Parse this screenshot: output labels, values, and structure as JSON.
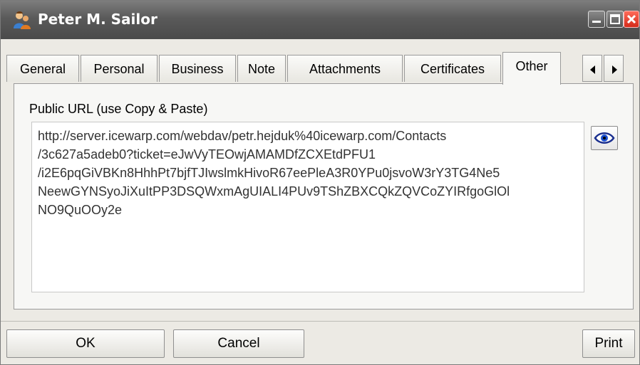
{
  "window": {
    "title": "Peter M. Sailor"
  },
  "tabs": [
    {
      "label": "General"
    },
    {
      "label": "Personal"
    },
    {
      "label": "Business"
    },
    {
      "label": "Note"
    },
    {
      "label": "Attachments"
    },
    {
      "label": "Certificates"
    },
    {
      "label": "Other"
    }
  ],
  "active_tab": "Other",
  "public_url": {
    "label": "Public URL (use Copy & Paste)",
    "lines": [
      "http://server.icewarp.com/webdav/petr.hejduk%40icewarp.com/Contacts",
      "/3c627a5adeb0?ticket=eJwVyTEOwjAMAMDfZCXEtdPFU1",
      "/i2E6pqGiVBKn8HhhPt7bjfTJIwslmkHivoR67eePleA3R0YPu0jsvoW3rY3TG4Ne5",
      "NeewGYNSyoJiXuItPP3DSQWxmAgUIALI4PUv9TShZBXCQkZQVCoZYIRfgoGlOl",
      "NO9QuOOy2e"
    ]
  },
  "buttons": {
    "ok": "OK",
    "cancel": "Cancel",
    "print": "Print"
  },
  "icons": {
    "app": "contact-person-icon",
    "minimize": "minimize-icon",
    "maximize": "maximize-icon",
    "close": "close-icon",
    "eye": "eye-icon",
    "tab_left": "arrow-left-icon",
    "tab_right": "arrow-right-icon"
  }
}
